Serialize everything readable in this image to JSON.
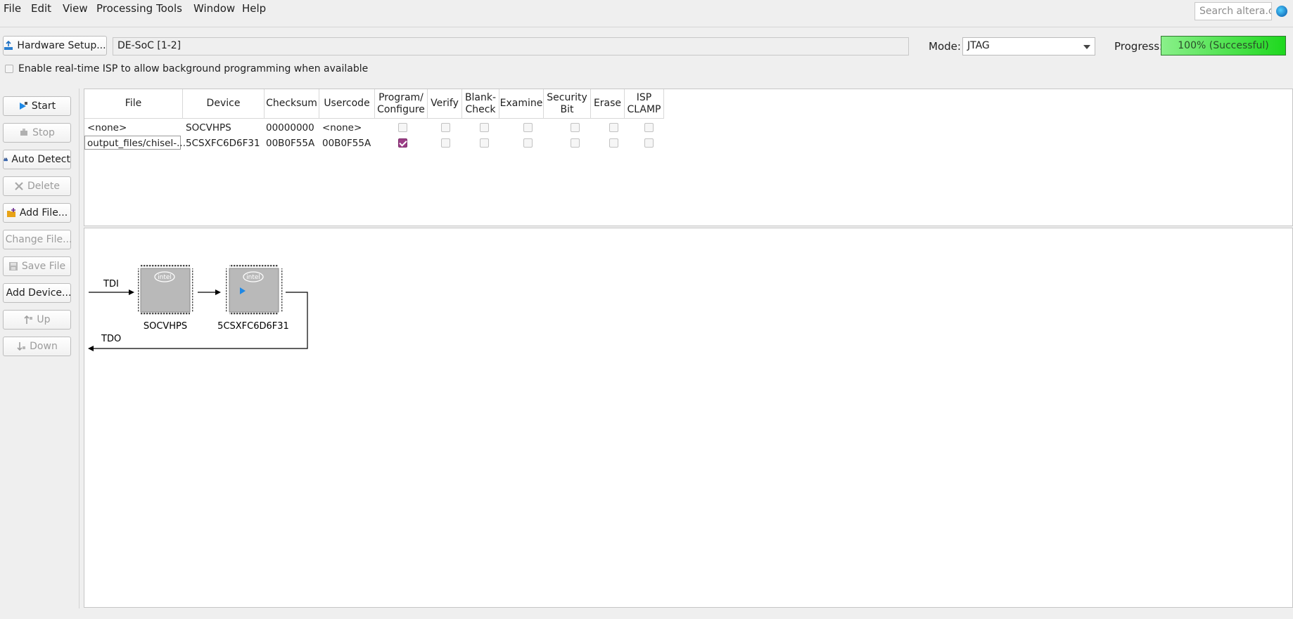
{
  "menu": [
    "File",
    "Edit",
    "View",
    "Processing",
    "Tools",
    "Window",
    "Help"
  ],
  "search": {
    "placeholder": "Search altera.c..."
  },
  "toolbar": {
    "hardware_setup": "Hardware Setup...",
    "hardware_value": "DE-SoC [1-2]",
    "mode_label": "Mode:",
    "mode_value": "JTAG",
    "progress_label": "Progress:",
    "progress_text": "100% (Successful)",
    "progress_fraction": 1.0,
    "isp_label": "Enable real-time ISP to allow background programming when available",
    "isp_checked": false
  },
  "side_buttons": [
    {
      "label": "Start",
      "enabled": true
    },
    {
      "label": "Stop",
      "enabled": false
    },
    {
      "label": "Auto Detect",
      "enabled": true
    },
    {
      "label": "Delete",
      "enabled": false
    },
    {
      "label": "Add File...",
      "enabled": true
    },
    {
      "label": "Change File...",
      "enabled": false
    },
    {
      "label": "Save File",
      "enabled": false
    },
    {
      "label": "Add Device...",
      "enabled": true
    },
    {
      "label": "Up",
      "enabled": false
    },
    {
      "label": "Down",
      "enabled": false
    }
  ],
  "table": {
    "headers": [
      "File",
      "Device",
      "Checksum",
      "Usercode",
      "Program/\nConfigure",
      "Verify",
      "Blank-\nCheck",
      "Examine",
      "Security\nBit",
      "Erase",
      "ISP\nCLAMP"
    ],
    "rows": [
      {
        "file": "<none>",
        "device": "SOCVHPS",
        "checksum": "00000000",
        "usercode": "<none>",
        "checks": [
          false,
          false,
          false,
          false,
          false,
          false,
          false
        ]
      },
      {
        "file": "output_files/chisel-...",
        "device": "5CSXFC6D6F31",
        "checksum": "00B0F55A",
        "usercode": "00B0F55A",
        "checks": [
          true,
          false,
          false,
          false,
          false,
          false,
          false
        ]
      }
    ]
  },
  "diagram": {
    "tdi": "TDI",
    "tdo": "TDO",
    "chip_logo": "intel",
    "devices": [
      "SOCVHPS",
      "5CSXFC6D6F31"
    ]
  }
}
